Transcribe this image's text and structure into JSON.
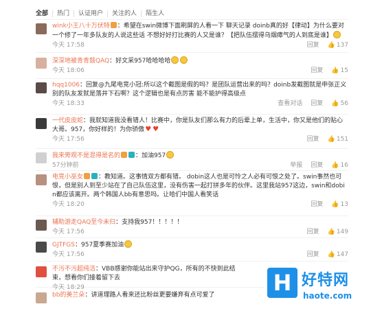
{
  "filters": [
    "全部",
    "热门",
    "认证用户",
    "关注的人",
    "陌生人"
  ],
  "comments": [
    {
      "username": "wink小王八十万伏特",
      "text": "：希望在swin微博下面刷屏的人看一下 聊天记录 doinb真的好【律动】为什么要对一个修了一年多队友的人说这些话 不想好好打比赛的人又是谁？【把队伍摆得乌烟瘴气的人到底是谁】",
      "time": "今天 17:58",
      "actions": [
        "回复"
      ],
      "likes": "137"
    },
    {
      "username": "深深地被青青鼓QAQ",
      "text": "：好文采957哈哈哈哈",
      "time": "今天 18:06",
      "actions": [
        "回复"
      ],
      "likes": "15"
    },
    {
      "username": "hqq1006",
      "text": "：回复@九尾电竞小冠:所以这个截图是假的吗？是团队运营出来的吗？doinb发截图就是申张正义 别的队友发就是落井下石啊？这个逻辑也是有点厉害 能不能护得高级点",
      "time": "今天 18:33",
      "actions": [
        "查看对话",
        "回复"
      ],
      "likes": "56"
    },
    {
      "username": "一代皮皮蛇",
      "text": "：我就知道我没看错人！比赛中，你是队友们那么有力的后辈上单，生活中，你又是他们的贴心大哥。957，你好样的！为你骄傲",
      "time": "今天 17:56",
      "actions": [
        "回复"
      ],
      "likes": "151"
    },
    {
      "username": "我来旁观不是混得是名的",
      "text": "：加油957",
      "time": "57分钟前",
      "actions": [
        "举报",
        "回复"
      ],
      "likes": "16"
    },
    {
      "username": "电竞小巫女",
      "text": "：教知道。这事情双方都有错。 dobin这人也是可怜之人必有可恨之处了。swin事然也可恨，但是别人到至少站在了自己队伍这里，没有伤害一起打拼多年的伙伴。这里我站957这边，swin和dobin都应该离开。两个韩国人bb有意思吗。让哈们中国人看笑话",
      "time": "今天 18:20",
      "actions": [
        "回复"
      ],
      "likes": "13"
    },
    {
      "username": "辅助游走QAQ至今未归",
      "text": "：支持我957！！！！！",
      "time": "今天 17:56",
      "actions": [
        "回复"
      ],
      "likes": "149"
    },
    {
      "username": "GJTFGS",
      "text": "：957夏季赛加油",
      "time": "今天 17:56",
      "actions": [
        "回复"
      ],
      "likes": "147"
    },
    {
      "username": "不污不污超纯洁",
      "text": "：VBB感谢你能站出来守护QG，所有的不快到此结束，想看你们接着留下去",
      "time": "今天 18:29",
      "actions": [],
      "likes": ""
    },
    {
      "username": "bb的美兰朵",
      "text": "：讲道理路人看来还比粉丝更要嫌弃有点可爱了",
      "time": "",
      "actions": [],
      "likes": ""
    }
  ],
  "watermark": {
    "cn": "好特网",
    "en": "haote.com",
    "logo": "H"
  },
  "colors": {
    "username": "#eb7350",
    "brand": "#1e90e8"
  }
}
